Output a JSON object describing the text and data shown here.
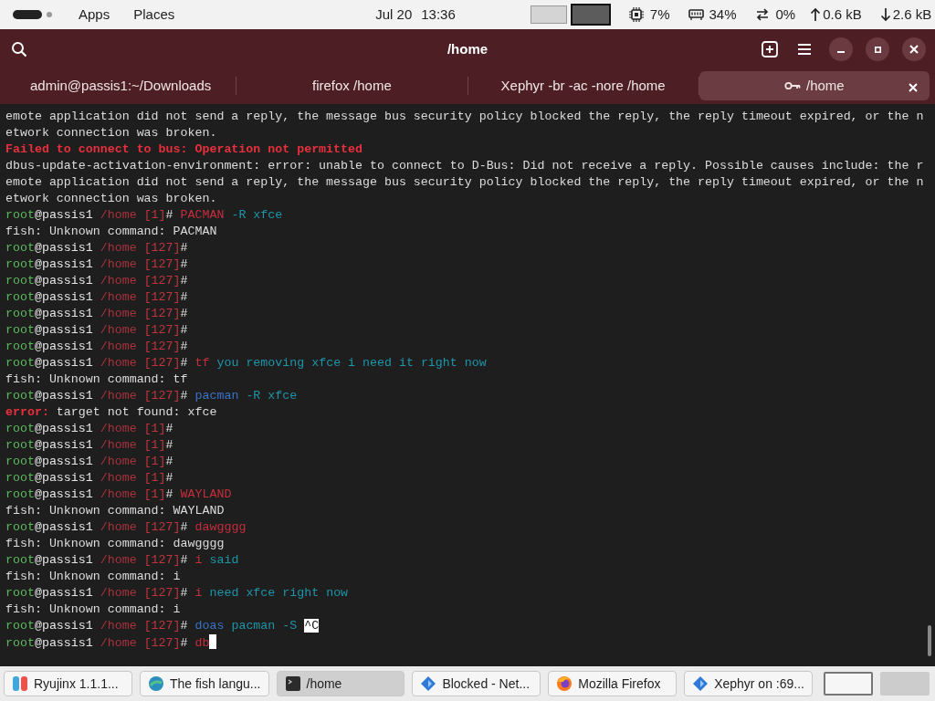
{
  "top_bar": {
    "menus": [
      "Apps",
      "Places"
    ],
    "date": "Jul 20",
    "time": "13:36",
    "workspaces": [
      {
        "selected": false
      },
      {
        "selected": true
      }
    ],
    "stats": [
      {
        "kind": "cpu",
        "value": "7%"
      },
      {
        "kind": "memory",
        "value": "34%"
      },
      {
        "kind": "swap",
        "value": "0%"
      },
      {
        "kind": "up",
        "value": "0.6 kB"
      },
      {
        "kind": "down",
        "value": "2.6 kB"
      }
    ]
  },
  "window": {
    "title": "/home"
  },
  "tabs": [
    {
      "label": "admin@passis1:~/Downloads",
      "selected": false,
      "locked": false
    },
    {
      "label": "firefox /home",
      "selected": false,
      "locked": false
    },
    {
      "label": "Xephyr -br -ac -nore /home",
      "selected": false,
      "locked": false
    },
    {
      "label": "/home",
      "selected": true,
      "locked": true
    }
  ],
  "terminal": {
    "lines": [
      {
        "segments": [
          {
            "text": "emote application did not send a reply, the message bus security policy blocked the reply, the reply timeout expired, or the n",
            "kind": "plain"
          }
        ]
      },
      {
        "segments": [
          {
            "text": "etwork connection was broken.",
            "kind": "plain"
          }
        ]
      },
      {
        "segments": [
          {
            "text": "Failed to connect to bus: Operation not permitted",
            "kind": "error"
          }
        ]
      },
      {
        "segments": [
          {
            "text": "dbus-update-activation-environment: error: unable to connect to D-Bus: Did not receive a reply. Possible causes include: the r",
            "kind": "plain"
          }
        ]
      },
      {
        "segments": [
          {
            "text": "emote application did not send a reply, the message bus security policy blocked the reply, the reply timeout expired, or the n",
            "kind": "plain"
          }
        ]
      },
      {
        "segments": [
          {
            "text": "etwork connection was broken.",
            "kind": "plain"
          }
        ]
      },
      {
        "segments": [
          {
            "text": "root",
            "kind": "user"
          },
          {
            "text": "@passis1 ",
            "kind": "host"
          },
          {
            "text": "/home ",
            "kind": "path"
          },
          {
            "text": "[1]",
            "kind": "status"
          },
          {
            "text": "# ",
            "kind": "host"
          },
          {
            "text": "PACMAN",
            "kind": "bad"
          },
          {
            "text": " -R xfce",
            "kind": "arg"
          }
        ]
      },
      {
        "segments": [
          {
            "text": "fish: Unknown command: PACMAN",
            "kind": "plain"
          }
        ]
      },
      {
        "segments": [
          {
            "text": "root",
            "kind": "user"
          },
          {
            "text": "@passis1 ",
            "kind": "host"
          },
          {
            "text": "/home ",
            "kind": "path"
          },
          {
            "text": "[127]",
            "kind": "status"
          },
          {
            "text": "#",
            "kind": "host"
          }
        ]
      },
      {
        "segments": [
          {
            "text": "root",
            "kind": "user"
          },
          {
            "text": "@passis1 ",
            "kind": "host"
          },
          {
            "text": "/home ",
            "kind": "path"
          },
          {
            "text": "[127]",
            "kind": "status"
          },
          {
            "text": "#",
            "kind": "host"
          }
        ]
      },
      {
        "segments": [
          {
            "text": "root",
            "kind": "user"
          },
          {
            "text": "@passis1 ",
            "kind": "host"
          },
          {
            "text": "/home ",
            "kind": "path"
          },
          {
            "text": "[127]",
            "kind": "status"
          },
          {
            "text": "#",
            "kind": "host"
          }
        ]
      },
      {
        "segments": [
          {
            "text": "root",
            "kind": "user"
          },
          {
            "text": "@passis1 ",
            "kind": "host"
          },
          {
            "text": "/home ",
            "kind": "path"
          },
          {
            "text": "[127]",
            "kind": "status"
          },
          {
            "text": "#",
            "kind": "host"
          }
        ]
      },
      {
        "segments": [
          {
            "text": "root",
            "kind": "user"
          },
          {
            "text": "@passis1 ",
            "kind": "host"
          },
          {
            "text": "/home ",
            "kind": "path"
          },
          {
            "text": "[127]",
            "kind": "status"
          },
          {
            "text": "#",
            "kind": "host"
          }
        ]
      },
      {
        "segments": [
          {
            "text": "root",
            "kind": "user"
          },
          {
            "text": "@passis1 ",
            "kind": "host"
          },
          {
            "text": "/home ",
            "kind": "path"
          },
          {
            "text": "[127]",
            "kind": "status"
          },
          {
            "text": "#",
            "kind": "host"
          }
        ]
      },
      {
        "segments": [
          {
            "text": "root",
            "kind": "user"
          },
          {
            "text": "@passis1 ",
            "kind": "host"
          },
          {
            "text": "/home ",
            "kind": "path"
          },
          {
            "text": "[127]",
            "kind": "status"
          },
          {
            "text": "#",
            "kind": "host"
          }
        ]
      },
      {
        "segments": [
          {
            "text": "root",
            "kind": "user"
          },
          {
            "text": "@passis1 ",
            "kind": "host"
          },
          {
            "text": "/home ",
            "kind": "path"
          },
          {
            "text": "[127]",
            "kind": "status"
          },
          {
            "text": "# ",
            "kind": "host"
          },
          {
            "text": "tf",
            "kind": "bad"
          },
          {
            "text": " you removing xfce i need it right now",
            "kind": "arg"
          }
        ]
      },
      {
        "segments": [
          {
            "text": "fish: Unknown command: tf",
            "kind": "plain"
          }
        ]
      },
      {
        "segments": [
          {
            "text": "root",
            "kind": "user"
          },
          {
            "text": "@passis1 ",
            "kind": "host"
          },
          {
            "text": "/home ",
            "kind": "path"
          },
          {
            "text": "[127]",
            "kind": "status"
          },
          {
            "text": "# ",
            "kind": "host"
          },
          {
            "text": "pacman",
            "kind": "cmd"
          },
          {
            "text": " -R xfce",
            "kind": "arg"
          }
        ]
      },
      {
        "segments": [
          {
            "text": "error:",
            "kind": "error"
          },
          {
            "text": " target not found: xfce",
            "kind": "plain"
          }
        ]
      },
      {
        "segments": [
          {
            "text": "root",
            "kind": "user"
          },
          {
            "text": "@passis1 ",
            "kind": "host"
          },
          {
            "text": "/home ",
            "kind": "path"
          },
          {
            "text": "[1]",
            "kind": "status"
          },
          {
            "text": "#",
            "kind": "host"
          }
        ]
      },
      {
        "segments": [
          {
            "text": "root",
            "kind": "user"
          },
          {
            "text": "@passis1 ",
            "kind": "host"
          },
          {
            "text": "/home ",
            "kind": "path"
          },
          {
            "text": "[1]",
            "kind": "status"
          },
          {
            "text": "#",
            "kind": "host"
          }
        ]
      },
      {
        "segments": [
          {
            "text": "root",
            "kind": "user"
          },
          {
            "text": "@passis1 ",
            "kind": "host"
          },
          {
            "text": "/home ",
            "kind": "path"
          },
          {
            "text": "[1]",
            "kind": "status"
          },
          {
            "text": "#",
            "kind": "host"
          }
        ]
      },
      {
        "segments": [
          {
            "text": "root",
            "kind": "user"
          },
          {
            "text": "@passis1 ",
            "kind": "host"
          },
          {
            "text": "/home ",
            "kind": "path"
          },
          {
            "text": "[1]",
            "kind": "status"
          },
          {
            "text": "#",
            "kind": "host"
          }
        ]
      },
      {
        "segments": [
          {
            "text": "root",
            "kind": "user"
          },
          {
            "text": "@passis1 ",
            "kind": "host"
          },
          {
            "text": "/home ",
            "kind": "path"
          },
          {
            "text": "[1]",
            "kind": "status"
          },
          {
            "text": "# ",
            "kind": "host"
          },
          {
            "text": "WAYLAND",
            "kind": "bad"
          }
        ]
      },
      {
        "segments": [
          {
            "text": "fish: Unknown command: WAYLAND",
            "kind": "plain"
          }
        ]
      },
      {
        "segments": [
          {
            "text": "root",
            "kind": "user"
          },
          {
            "text": "@passis1 ",
            "kind": "host"
          },
          {
            "text": "/home ",
            "kind": "path"
          },
          {
            "text": "[127]",
            "kind": "status"
          },
          {
            "text": "# ",
            "kind": "host"
          },
          {
            "text": "dawgggg",
            "kind": "bad"
          }
        ]
      },
      {
        "segments": [
          {
            "text": "fish: Unknown command: dawgggg",
            "kind": "plain"
          }
        ]
      },
      {
        "segments": [
          {
            "text": "root",
            "kind": "user"
          },
          {
            "text": "@passis1 ",
            "kind": "host"
          },
          {
            "text": "/home ",
            "kind": "path"
          },
          {
            "text": "[127]",
            "kind": "status"
          },
          {
            "text": "# ",
            "kind": "host"
          },
          {
            "text": "i",
            "kind": "bad"
          },
          {
            "text": " said",
            "kind": "arg"
          }
        ]
      },
      {
        "segments": [
          {
            "text": "fish: Unknown command: i",
            "kind": "plain"
          }
        ]
      },
      {
        "segments": [
          {
            "text": "root",
            "kind": "user"
          },
          {
            "text": "@passis1 ",
            "kind": "host"
          },
          {
            "text": "/home ",
            "kind": "path"
          },
          {
            "text": "[127]",
            "kind": "status"
          },
          {
            "text": "# ",
            "kind": "host"
          },
          {
            "text": "i",
            "kind": "bad"
          },
          {
            "text": " need xfce right now",
            "kind": "arg"
          }
        ]
      },
      {
        "segments": [
          {
            "text": "fish: Unknown command: i",
            "kind": "plain"
          }
        ]
      },
      {
        "segments": [
          {
            "text": "root",
            "kind": "user"
          },
          {
            "text": "@passis1 ",
            "kind": "host"
          },
          {
            "text": "/home ",
            "kind": "path"
          },
          {
            "text": "[127]",
            "kind": "status"
          },
          {
            "text": "# ",
            "kind": "host"
          },
          {
            "text": "doas",
            "kind": "cmd"
          },
          {
            "text": " pacman -S ",
            "kind": "arg"
          },
          {
            "text": "^C",
            "kind": "inverse"
          }
        ]
      },
      {
        "segments": [
          {
            "text": "root",
            "kind": "user"
          },
          {
            "text": "@passis1 ",
            "kind": "host"
          },
          {
            "text": "/home ",
            "kind": "path"
          },
          {
            "text": "[127]",
            "kind": "status"
          },
          {
            "text": "# ",
            "kind": "host"
          },
          {
            "text": "db",
            "kind": "bad"
          }
        ],
        "cursor": true
      }
    ]
  },
  "taskbar": {
    "items": [
      {
        "label": "Ryujinx 1.1.1...",
        "kind": "split",
        "selected": false
      },
      {
        "label": "The fish langu...",
        "kind": "globe",
        "selected": false
      },
      {
        "label": "/home",
        "kind": "terminal",
        "selected": true
      },
      {
        "label": "Blocked - Net...",
        "kind": "diamond",
        "selected": false
      },
      {
        "label": "Mozilla Firefox",
        "kind": "firefox",
        "selected": false
      },
      {
        "label": "Xephyr on :69...",
        "kind": "diamond",
        "selected": false
      }
    ],
    "workspaces": [
      {
        "selected": true
      },
      {
        "selected": false
      }
    ]
  }
}
